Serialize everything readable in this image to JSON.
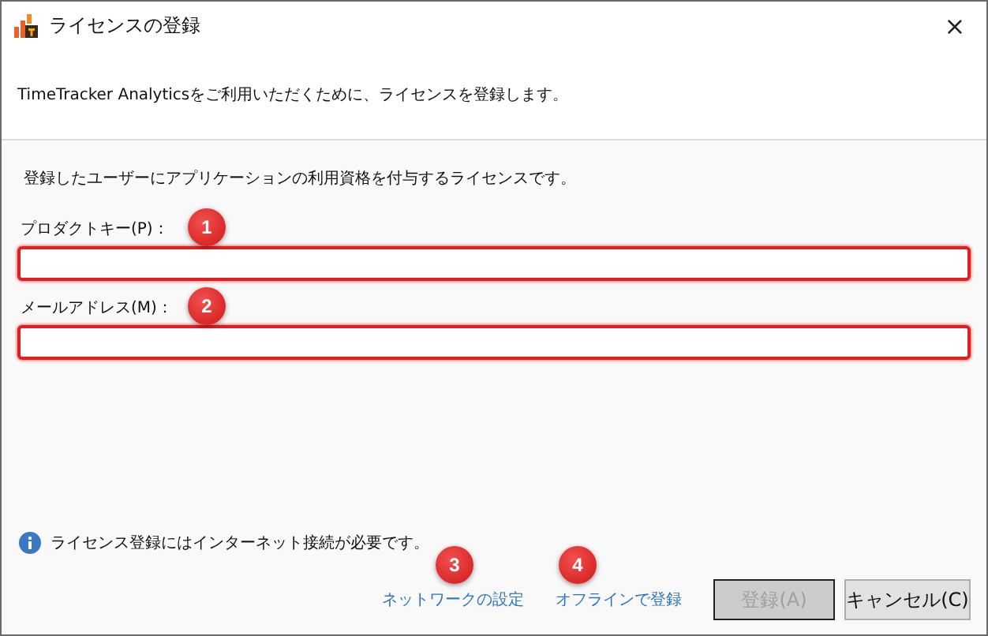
{
  "window": {
    "title": "ライセンスの登録",
    "close": "×"
  },
  "header": {
    "text": "TimeTracker Analyticsをご利用いただくために、ライセンスを登録します。"
  },
  "description": "登録したユーザーにアプリケーションの利用資格を付与するライセンスです。",
  "fields": [
    {
      "label": "プロダクトキー(P)：",
      "highlighted": true,
      "callout": "1"
    },
    {
      "label": "メールアドレス(M)：",
      "highlighted": true,
      "callout": "2"
    }
  ],
  "info": "ライセンス登録にはインターネット接続が必要です。",
  "links": [
    {
      "label": "ネットワークの設定",
      "callout": "3"
    },
    {
      "label": "オフラインで登録",
      "callout": "4"
    }
  ],
  "buttons": [
    {
      "label": "登録(A)",
      "disabled": true
    },
    {
      "label": "キャンセル(C)",
      "disabled": false
    }
  ]
}
